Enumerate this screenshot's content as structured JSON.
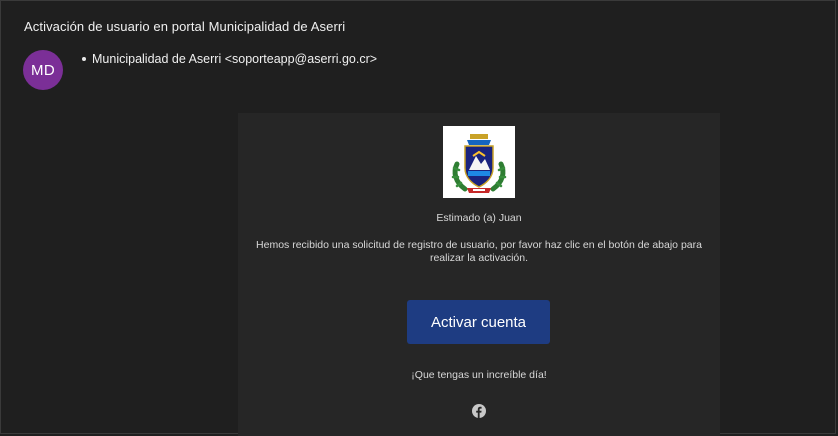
{
  "email": {
    "subject": "Activación de usuario en portal Municipalidad de Aserri",
    "avatar_initials": "MD",
    "avatar_color": "#7b2f97",
    "sender": "Municipalidad de Aserri <soporteapp@aserri.go.cr>"
  },
  "body": {
    "logo_icon": "municipal-crest-icon",
    "greeting": "Estimado (a) Juan",
    "message": "Hemos recibido una solicitud de registro de usuario, por favor haz clic en el botón de abajo para realizar la activación.",
    "button_label": "Activar cuenta",
    "button_color": "#1e3c82",
    "closing": "¡Que tengas un increíble día!",
    "social_icon": "facebook-icon"
  },
  "colors": {
    "background": "#1f1f1f",
    "card": "#262626"
  }
}
